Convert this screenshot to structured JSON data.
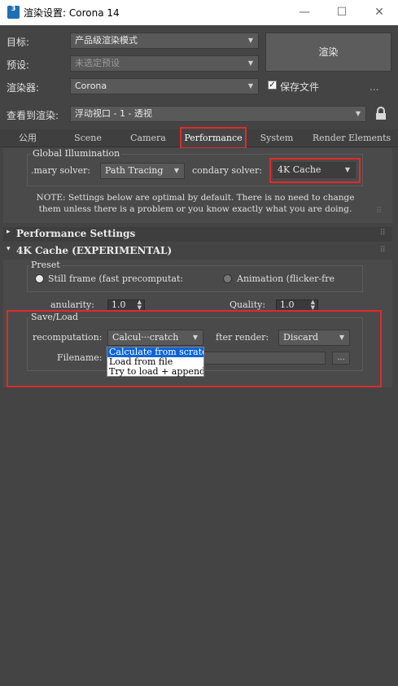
{
  "window": {
    "title": "渲染设置: Corona 14",
    "app_badge": "3",
    "minimize": "—",
    "maximize": "☐",
    "close": "✕"
  },
  "top": {
    "target_label": "目标:",
    "target_value": "产品级渲染模式",
    "preset_label": "预设:",
    "preset_value": "未选定预设",
    "renderer_label": "渲染器:",
    "renderer_value": "Corona",
    "save_file_label": "保存文件",
    "save_file_checked": true,
    "render_button": "渲染",
    "more_dots": "...",
    "view_label": "查看到渲染:",
    "view_value": "浮动视口 - 1 - 透视"
  },
  "tabs": [
    "公用",
    "Scene",
    "Camera",
    "Performance",
    "System",
    "Render Elements"
  ],
  "active_tab": "Performance",
  "global_illumination": {
    "title": "Global Illumination",
    "primary_label": ".mary solver:",
    "primary_value": "Path Tracing",
    "secondary_label": "condary solver:",
    "secondary_value": "4K Cache",
    "note": "NOTE: Settings below are optimal by default. There is no need to change them unless there is a problem or you know exactly what you are doing."
  },
  "performance_settings": {
    "title": "Performance Settings",
    "expander": "▸"
  },
  "cache": {
    "title": "4K Cache (EXPERIMENTAL)",
    "expander": "▾",
    "preset_title": "Preset",
    "still_frame": "Still frame (fast precomputat:",
    "animation": "Animation (flicker-fre",
    "still_selected": true,
    "granularity_label": "anularity:",
    "granularity_value": "1.0",
    "quality_label": "Quality:",
    "quality_value": "1.0",
    "saveload_title": "Save/Load",
    "precomp_label": "recomputation:",
    "precomp_value": "Calcul···cratch",
    "after_render_label": "fter render:",
    "after_render_value": "Discard",
    "filename_label": "Filename:",
    "browse": "...",
    "options": [
      "Calculate from scratch",
      "Load from file",
      "Try to load + append"
    ],
    "selected_option": 0
  },
  "lock_icon": "lock-icon",
  "colors": {
    "highlight": "#e12a2a",
    "selection": "#0a64d8"
  }
}
